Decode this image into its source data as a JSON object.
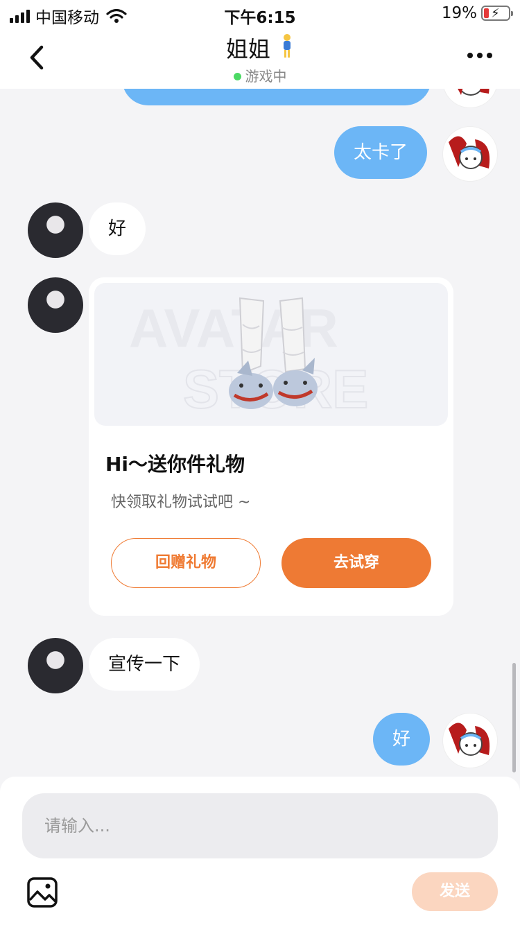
{
  "status_bar": {
    "carrier": "中国移动",
    "time": "下午6:15",
    "battery": "19%"
  },
  "header": {
    "title": "姐姐",
    "status": "游戏中"
  },
  "messages": [
    {
      "from": "me",
      "text": ""
    },
    {
      "from": "me",
      "text": "太卡了"
    },
    {
      "from": "her",
      "text": "好"
    },
    {
      "from": "her",
      "type": "gift"
    },
    {
      "from": "her",
      "text": "宣传一下"
    },
    {
      "from": "me",
      "text": "好"
    }
  ],
  "gift_card": {
    "watermark_1": "AVATAR",
    "watermark_2": "STORE",
    "title": "Hi～送你件礼物",
    "subtitle": "快领取礼物试试吧 ~",
    "return_button": "回赠礼物",
    "try_button": "去试穿"
  },
  "composer": {
    "placeholder": "请输入...",
    "send_label": "发送"
  },
  "colors": {
    "outgoing_bubble": "#6cb6f6",
    "accent_orange": "#ee7a34",
    "send_disabled": "#fbd6c0",
    "online_dot": "#4cd964"
  }
}
